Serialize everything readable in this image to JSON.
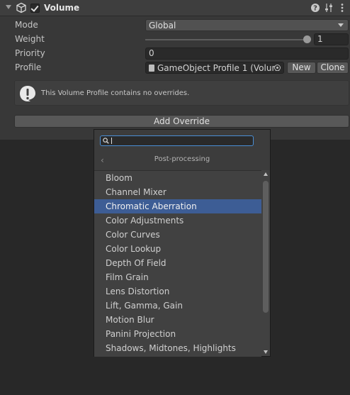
{
  "component": {
    "title": "Volume",
    "enabled": true,
    "icons": [
      "cube-icon",
      "help-icon",
      "presets-icon",
      "more-icon"
    ]
  },
  "fields": {
    "mode": {
      "label": "Mode",
      "value": "Global"
    },
    "weight": {
      "label": "Weight",
      "value": "1",
      "fraction": 1.0
    },
    "priority": {
      "label": "Priority",
      "value": "0"
    },
    "profile": {
      "label": "Profile",
      "value": "GameObject Profile 1 (Volum",
      "new_label": "New",
      "clone_label": "Clone"
    }
  },
  "help": {
    "icon": "info-icon",
    "message": "This Volume Profile contains no overrides."
  },
  "add_override_label": "Add Override",
  "popup": {
    "search_value": "",
    "header": "Post-processing",
    "items": [
      "Bloom",
      "Channel Mixer",
      "Chromatic Aberration",
      "Color Adjustments",
      "Color Curves",
      "Color Lookup",
      "Depth Of Field",
      "Film Grain",
      "Lens Distortion",
      "Lift, Gamma, Gain",
      "Motion Blur",
      "Panini Projection",
      "Shadows, Midtones, Highlights"
    ],
    "selected_index": 2
  },
  "colors": {
    "selection": "#3d5d95",
    "focus": "#4a8fd6"
  }
}
